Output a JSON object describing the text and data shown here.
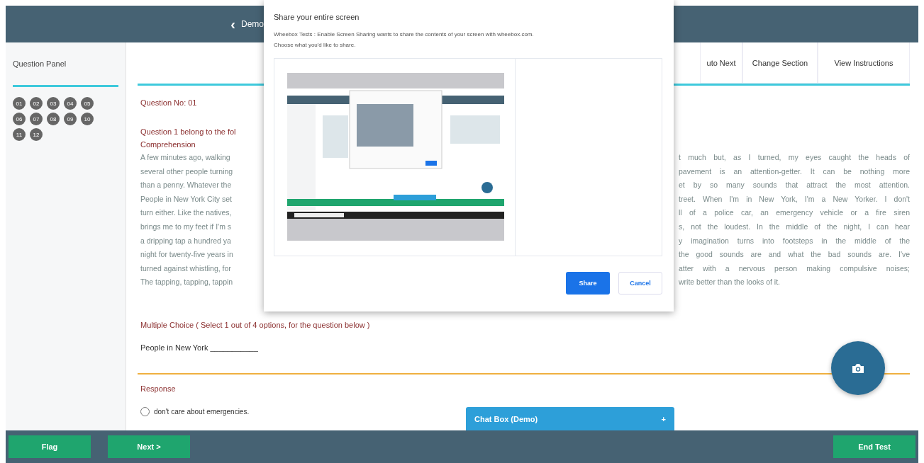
{
  "header": {
    "back_icon": "‹",
    "title": "Demo"
  },
  "sidebar": {
    "title": "Question Panel",
    "questions": [
      {
        "label": "01"
      },
      {
        "label": "02"
      },
      {
        "label": "03"
      },
      {
        "label": "04"
      },
      {
        "label": "05"
      },
      {
        "label": "06"
      },
      {
        "label": "07"
      },
      {
        "label": "08"
      },
      {
        "label": "09"
      },
      {
        "label": "10"
      },
      {
        "label": "11"
      },
      {
        "label": "12"
      }
    ]
  },
  "toolbar": [
    "uto Next",
    "Change Section",
    "View Instructions"
  ],
  "question": {
    "number": "Question No: 01",
    "intro": [
      "Question 1 belong to the fol",
      "Comprehension"
    ],
    "passage_left": [
      "A few minutes ago, walking",
      "several other people turning",
      "than a penny. Whatever the",
      "People in New York City set",
      "turn either. Like the natives,",
      "brings me to my feet if I'm s",
      "a dripping tap a hundred ya",
      "night for twenty-five years in",
      "turned against whistling, for",
      "The tapping, tapping, tappin"
    ],
    "passage_right": [
      "t much but, as I turned, my eyes caught the heads of",
      "pavement is an attention-getter. It can be nothing more",
      "et by so many sounds that attract the most attention.",
      "treet. When I'm in New York, I'm a New Yorker. I don't",
      "ll of a police car, an emergency vehicle or a fire siren",
      "s, not the loudest. In the middle of the night, I can hear",
      "y imagination turns into footsteps in the middle of the",
      "the good sounds are and what the bad sounds are. I've",
      "atter with a nervous person making compulsive noises;",
      "write better than the looks of it."
    ],
    "instruction": "Multiple Choice ( Select 1 out of 4 options, for the question below )",
    "prompt": "People in New York ___________"
  },
  "response": {
    "title": "Response",
    "options": [
      {
        "label": "don't care about emergencies.",
        "selected": false
      }
    ]
  },
  "chat_box": {
    "title": "Chat Box (Demo)",
    "icon": "+"
  },
  "footer": {
    "left_buttons": [
      "Flag",
      "Next >"
    ],
    "right_button": "End Test"
  },
  "dialog": {
    "title": "Share your entire screen",
    "message": "Wheebox Tests : Enable Screen Sharing wants to share the contents of your screen with wheebox.com.",
    "hint": "Choose what you'd like to share.",
    "buttons": [
      {
        "label": "Share",
        "kind": "primary"
      },
      {
        "label": "Cancel",
        "kind": "secondary"
      }
    ]
  }
}
